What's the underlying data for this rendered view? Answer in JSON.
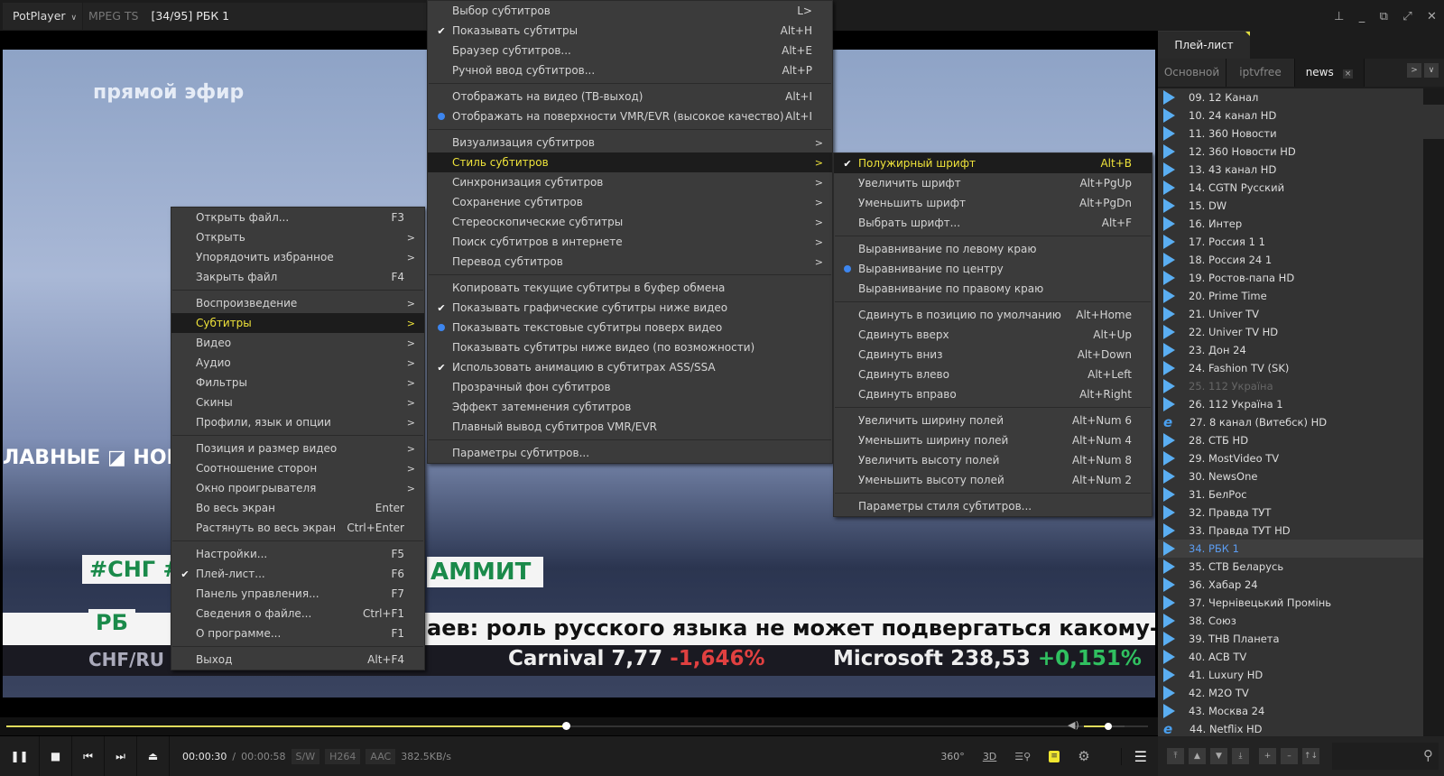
{
  "titlebar": {
    "app": "PotPlayer",
    "format": "MPEG TS",
    "title": "[34/95] РБК 1",
    "buttons": [
      "pin",
      "minimize",
      "restore",
      "fullscreen",
      "close"
    ]
  },
  "video": {
    "overlay_texts": {
      "live": "прямой эфир",
      "headline_left": "ЛАВНЫЕ ◪ НОВО",
      "hashtag": "#СНГ #",
      "summit": "АММИТ",
      "logo": "РБ",
      "currency": "CHF/RU",
      "crawl": "аев: роль русского языка не может подвергаться какому-л",
      "ticker1_name": "Carnival",
      "ticker1_value": "7,77",
      "ticker1_change": "-1,646%",
      "ticker2_name": "Microsoft",
      "ticker2_value": "238,53",
      "ticker2_change": "+0,151%"
    }
  },
  "seek": {
    "progress": 0.49,
    "volume": 0.6
  },
  "controls": {
    "current_time": "00:00:30",
    "separator": "/",
    "total_time": "00:00:58",
    "badges": [
      "S/W",
      "H264",
      "AAC"
    ],
    "bitrate": "382.5KB/s",
    "right": {
      "vr": "360°",
      "stereo": "3D"
    }
  },
  "accent": "#e0dc5c",
  "main_menu": {
    "items": [
      {
        "label": "Открыть файл...",
        "shortcut": "F3"
      },
      {
        "label": "Открыть",
        "submenu": true
      },
      {
        "label": "Упорядочить избранное",
        "submenu": true
      },
      {
        "label": "Закрыть файл",
        "shortcut": "F4"
      },
      {
        "sep": true
      },
      {
        "label": "Воспроизведение",
        "submenu": true
      },
      {
        "label": "Субтитры",
        "submenu": true,
        "highlight": true
      },
      {
        "label": "Видео",
        "submenu": true
      },
      {
        "label": "Аудио",
        "submenu": true
      },
      {
        "label": "Фильтры",
        "submenu": true
      },
      {
        "label": "Скины",
        "submenu": true
      },
      {
        "label": "Профили, язык и опции",
        "submenu": true
      },
      {
        "sep": true
      },
      {
        "label": "Позиция и размер видео",
        "submenu": true
      },
      {
        "label": "Соотношение сторон",
        "submenu": true
      },
      {
        "label": "Окно проигрывателя",
        "submenu": true
      },
      {
        "label": "Во весь экран",
        "shortcut": "Enter"
      },
      {
        "label": "Растянуть во весь экран",
        "shortcut": "Ctrl+Enter"
      },
      {
        "sep": true
      },
      {
        "label": "Настройки...",
        "shortcut": "F5"
      },
      {
        "label": "Плей-лист...",
        "shortcut": "F6",
        "mark": "check"
      },
      {
        "label": "Панель управления...",
        "shortcut": "F7"
      },
      {
        "label": "Сведения о файле...",
        "shortcut": "Ctrl+F1"
      },
      {
        "label": "О программе...",
        "shortcut": "F1"
      },
      {
        "sep": true
      },
      {
        "label": "Выход",
        "shortcut": "Alt+F4"
      }
    ]
  },
  "subtitle_menu": {
    "items": [
      {
        "label": "Выбор субтитров",
        "shortcut": "L>"
      },
      {
        "label": "Показывать субтитры",
        "shortcut": "Alt+H",
        "mark": "check"
      },
      {
        "label": "Браузер субтитров...",
        "shortcut": "Alt+E"
      },
      {
        "label": "Ручной ввод субтитров...",
        "shortcut": "Alt+P"
      },
      {
        "sep": true
      },
      {
        "label": "Отображать на видео (ТВ-выход)",
        "shortcut": "Alt+I"
      },
      {
        "label": "Отображать на поверхности VMR/EVR (высокое качество)",
        "shortcut": "Alt+I",
        "mark": "dot"
      },
      {
        "sep": true
      },
      {
        "label": "Визуализация субтитров",
        "submenu": true
      },
      {
        "label": "Стиль субтитров",
        "submenu": true,
        "highlight": true
      },
      {
        "label": "Синхронизация субтитров",
        "submenu": true
      },
      {
        "label": "Сохранение субтитров",
        "submenu": true
      },
      {
        "label": "Стереоскопические субтитры",
        "submenu": true
      },
      {
        "label": "Поиск субтитров в интернете",
        "submenu": true
      },
      {
        "label": "Перевод субтитров",
        "submenu": true
      },
      {
        "sep": true
      },
      {
        "label": "Копировать текущие субтитры в буфер обмена"
      },
      {
        "label": "Показывать графические субтитры ниже видео",
        "mark": "check"
      },
      {
        "label": "Показывать текстовые субтитры поверх видео",
        "mark": "dot"
      },
      {
        "label": "Показывать субтитры ниже видео (по возможности)"
      },
      {
        "label": "Использовать анимацию в субтитрах ASS/SSA",
        "mark": "check"
      },
      {
        "label": "Прозрачный фон субтитров"
      },
      {
        "label": "Эффект затемнения субтитров"
      },
      {
        "label": "Плавный вывод субтитров VMR/EVR"
      },
      {
        "sep": true
      },
      {
        "label": "Параметры субтитров..."
      }
    ]
  },
  "style_menu": {
    "items": [
      {
        "label": "Полужирный шрифт",
        "shortcut": "Alt+B",
        "mark": "check",
        "highlight": true
      },
      {
        "label": "Увеличить шрифт",
        "shortcut": "Alt+PgUp"
      },
      {
        "label": "Уменьшить шрифт",
        "shortcut": "Alt+PgDn"
      },
      {
        "label": "Выбрать шрифт...",
        "shortcut": "Alt+F"
      },
      {
        "sep": true
      },
      {
        "label": "Выравнивание по левому краю"
      },
      {
        "label": "Выравнивание по центру",
        "mark": "dot"
      },
      {
        "label": "Выравнивание по правому краю"
      },
      {
        "sep": true
      },
      {
        "label": "Сдвинуть в позицию по умолчанию",
        "shortcut": "Alt+Home"
      },
      {
        "label": "Сдвинуть вверх",
        "shortcut": "Alt+Up"
      },
      {
        "label": "Сдвинуть вниз",
        "shortcut": "Alt+Down"
      },
      {
        "label": "Сдвинуть влево",
        "shortcut": "Alt+Left"
      },
      {
        "label": "Сдвинуть вправо",
        "shortcut": "Alt+Right"
      },
      {
        "sep": true
      },
      {
        "label": "Увеличить ширину полей",
        "shortcut": "Alt+Num 6"
      },
      {
        "label": "Уменьшить ширину полей",
        "shortcut": "Alt+Num 4"
      },
      {
        "label": "Увеличить высоту полей",
        "shortcut": "Alt+Num 8"
      },
      {
        "label": "Уменьшить высоту полей",
        "shortcut": "Alt+Num 2"
      },
      {
        "sep": true
      },
      {
        "label": "Параметры стиля субтитров..."
      }
    ]
  },
  "playlist": {
    "title": "Плей-лист",
    "tabs": [
      {
        "label": "Основной"
      },
      {
        "label": "iptvfree"
      },
      {
        "label": "news",
        "active": true,
        "close": "×"
      }
    ],
    "items": [
      {
        "label": "09. 12 Канал"
      },
      {
        "label": "10. 24 канал HD"
      },
      {
        "label": "11. 360 Новости"
      },
      {
        "label": "12. 360 Новости HD"
      },
      {
        "label": "13. 43 канал HD"
      },
      {
        "label": "14. CGTN Русский"
      },
      {
        "label": "15. DW"
      },
      {
        "label": "16. Интер"
      },
      {
        "label": "17. Россия 1 1"
      },
      {
        "label": "18. Россия 24 1"
      },
      {
        "label": "19. Ростов-папа HD"
      },
      {
        "label": "20. Prime Time"
      },
      {
        "label": "21. Univer TV"
      },
      {
        "label": "22. Univer TV HD"
      },
      {
        "label": "23. Дон 24"
      },
      {
        "label": "24. Fashion TV (SK)"
      },
      {
        "label": "25. 112 Україна",
        "dim": true
      },
      {
        "label": "26. 112 Україна 1"
      },
      {
        "label": "27. 8 канал (Витебск) HD",
        "icon": "ie"
      },
      {
        "label": "28. СТБ HD"
      },
      {
        "label": "29. MostVideo TV"
      },
      {
        "label": "30. NewsOne"
      },
      {
        "label": "31. БелРос"
      },
      {
        "label": "32. Правда ТУТ"
      },
      {
        "label": "33. Правда ТУТ HD"
      },
      {
        "label": "34. РБК 1",
        "selected": true
      },
      {
        "label": "35. СТВ Беларусь"
      },
      {
        "label": "36. Хабар 24"
      },
      {
        "label": "37. Чернівецький Промінь"
      },
      {
        "label": "38. Союз"
      },
      {
        "label": "39. ТНВ Планета"
      },
      {
        "label": "40. АСВ TV"
      },
      {
        "label": "41. Luxury HD"
      },
      {
        "label": "42. M2O TV"
      },
      {
        "label": "43. Москва 24"
      },
      {
        "label": "44. Netflix HD",
        "icon": "ie"
      }
    ]
  }
}
